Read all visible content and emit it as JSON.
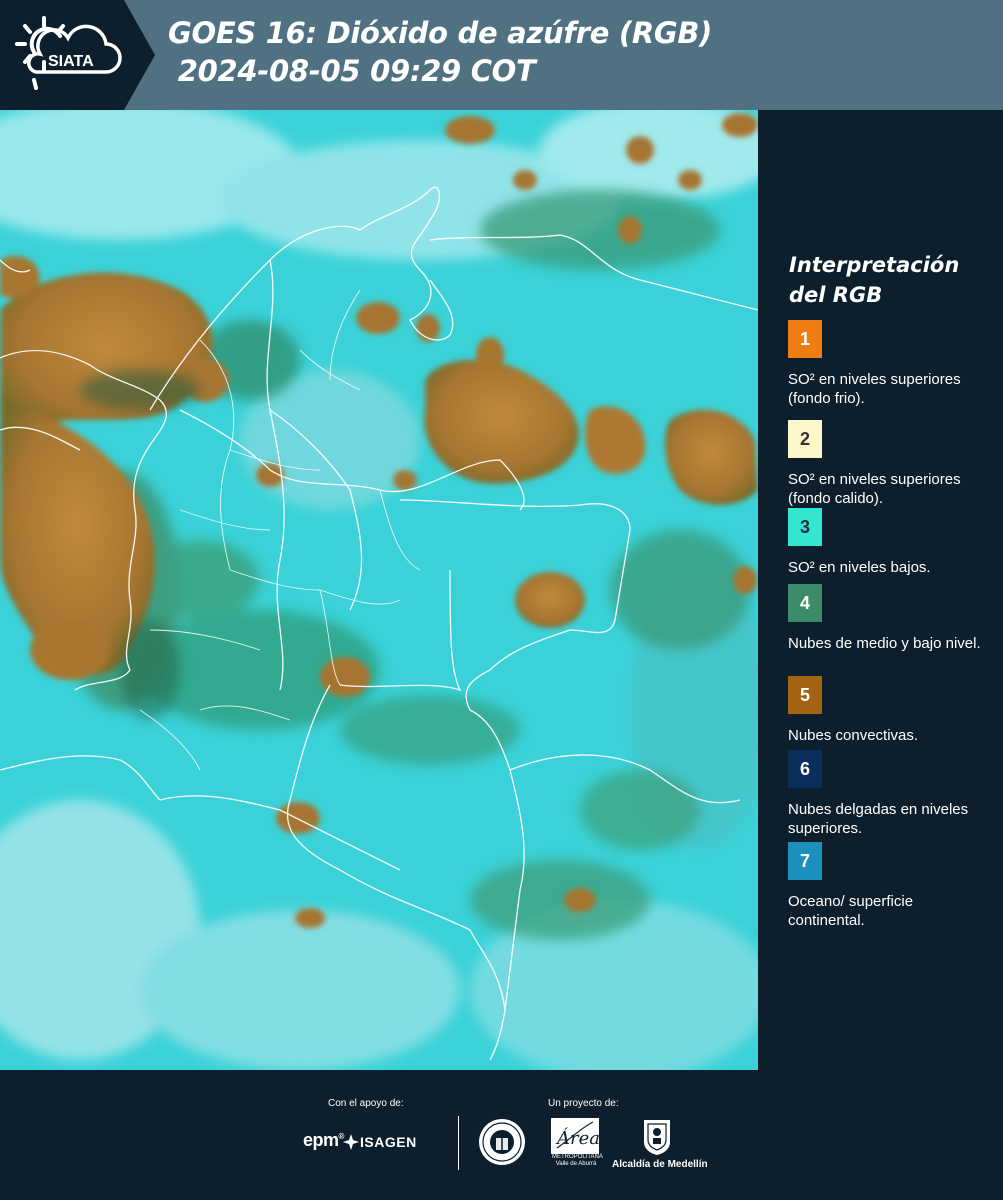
{
  "header": {
    "logo_text": "SIATA",
    "title": "GOES 16: Dióxido de azúfre (RGB)\n 2024-08-05 09:29 COT"
  },
  "legend": {
    "title": "Interpretación del RGB",
    "items": [
      {
        "number": "1",
        "color": "#f07d14",
        "number_color": "#ffffff",
        "text": "SO² en niveles superiores (fondo frio)."
      },
      {
        "number": "2",
        "color": "#fdf6c8",
        "number_color": "#333333",
        "text": "SO² en niveles superiores (fondo calido)."
      },
      {
        "number": "3",
        "color": "#33e6cf",
        "number_color": "#1a3340",
        "text": "SO² en niveles bajos."
      },
      {
        "number": "4",
        "color": "#3d8c69",
        "number_color": "#ffffff",
        "text": "Nubes de medio y bajo nivel."
      },
      {
        "number": "5",
        "color": "#a26410",
        "number_color": "#ffffff",
        "text": "Nubes convectivas."
      },
      {
        "number": "6",
        "color": "#0a2f5c",
        "number_color": "#ffffff",
        "text": "Nubes delgadas en niveles superiores."
      },
      {
        "number": "7",
        "color": "#1d8fbc",
        "number_color": "#ffffff",
        "text": "Oceano/ superficie continental."
      }
    ]
  },
  "footer": {
    "support_label": "Con el apoyo de:",
    "project_label": "Un proyecto de:",
    "epm": "epm",
    "isagen": "ISAGEN",
    "metropolitana": "METROPOLITANA Valle de Aburrá",
    "area": "Área",
    "alcaldia": "Alcaldía de Medellín"
  }
}
